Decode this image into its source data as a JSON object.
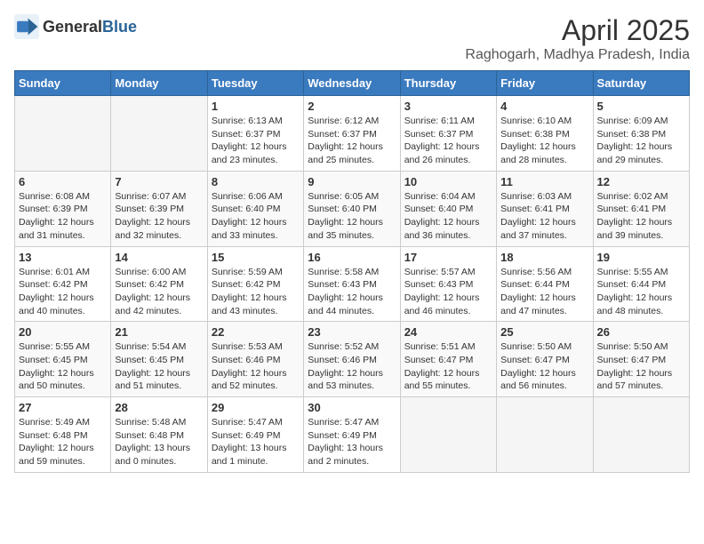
{
  "header": {
    "logo_general": "General",
    "logo_blue": "Blue",
    "title": "April 2025",
    "subtitle": "Raghogarh, Madhya Pradesh, India"
  },
  "calendar": {
    "days_of_week": [
      "Sunday",
      "Monday",
      "Tuesday",
      "Wednesday",
      "Thursday",
      "Friday",
      "Saturday"
    ],
    "weeks": [
      [
        {
          "day": "",
          "sunrise": "",
          "sunset": "",
          "daylight": ""
        },
        {
          "day": "",
          "sunrise": "",
          "sunset": "",
          "daylight": ""
        },
        {
          "day": "1",
          "sunrise": "Sunrise: 6:13 AM",
          "sunset": "Sunset: 6:37 PM",
          "daylight": "Daylight: 12 hours and 23 minutes."
        },
        {
          "day": "2",
          "sunrise": "Sunrise: 6:12 AM",
          "sunset": "Sunset: 6:37 PM",
          "daylight": "Daylight: 12 hours and 25 minutes."
        },
        {
          "day": "3",
          "sunrise": "Sunrise: 6:11 AM",
          "sunset": "Sunset: 6:37 PM",
          "daylight": "Daylight: 12 hours and 26 minutes."
        },
        {
          "day": "4",
          "sunrise": "Sunrise: 6:10 AM",
          "sunset": "Sunset: 6:38 PM",
          "daylight": "Daylight: 12 hours and 28 minutes."
        },
        {
          "day": "5",
          "sunrise": "Sunrise: 6:09 AM",
          "sunset": "Sunset: 6:38 PM",
          "daylight": "Daylight: 12 hours and 29 minutes."
        }
      ],
      [
        {
          "day": "6",
          "sunrise": "Sunrise: 6:08 AM",
          "sunset": "Sunset: 6:39 PM",
          "daylight": "Daylight: 12 hours and 31 minutes."
        },
        {
          "day": "7",
          "sunrise": "Sunrise: 6:07 AM",
          "sunset": "Sunset: 6:39 PM",
          "daylight": "Daylight: 12 hours and 32 minutes."
        },
        {
          "day": "8",
          "sunrise": "Sunrise: 6:06 AM",
          "sunset": "Sunset: 6:40 PM",
          "daylight": "Daylight: 12 hours and 33 minutes."
        },
        {
          "day": "9",
          "sunrise": "Sunrise: 6:05 AM",
          "sunset": "Sunset: 6:40 PM",
          "daylight": "Daylight: 12 hours and 35 minutes."
        },
        {
          "day": "10",
          "sunrise": "Sunrise: 6:04 AM",
          "sunset": "Sunset: 6:40 PM",
          "daylight": "Daylight: 12 hours and 36 minutes."
        },
        {
          "day": "11",
          "sunrise": "Sunrise: 6:03 AM",
          "sunset": "Sunset: 6:41 PM",
          "daylight": "Daylight: 12 hours and 37 minutes."
        },
        {
          "day": "12",
          "sunrise": "Sunrise: 6:02 AM",
          "sunset": "Sunset: 6:41 PM",
          "daylight": "Daylight: 12 hours and 39 minutes."
        }
      ],
      [
        {
          "day": "13",
          "sunrise": "Sunrise: 6:01 AM",
          "sunset": "Sunset: 6:42 PM",
          "daylight": "Daylight: 12 hours and 40 minutes."
        },
        {
          "day": "14",
          "sunrise": "Sunrise: 6:00 AM",
          "sunset": "Sunset: 6:42 PM",
          "daylight": "Daylight: 12 hours and 42 minutes."
        },
        {
          "day": "15",
          "sunrise": "Sunrise: 5:59 AM",
          "sunset": "Sunset: 6:42 PM",
          "daylight": "Daylight: 12 hours and 43 minutes."
        },
        {
          "day": "16",
          "sunrise": "Sunrise: 5:58 AM",
          "sunset": "Sunset: 6:43 PM",
          "daylight": "Daylight: 12 hours and 44 minutes."
        },
        {
          "day": "17",
          "sunrise": "Sunrise: 5:57 AM",
          "sunset": "Sunset: 6:43 PM",
          "daylight": "Daylight: 12 hours and 46 minutes."
        },
        {
          "day": "18",
          "sunrise": "Sunrise: 5:56 AM",
          "sunset": "Sunset: 6:44 PM",
          "daylight": "Daylight: 12 hours and 47 minutes."
        },
        {
          "day": "19",
          "sunrise": "Sunrise: 5:55 AM",
          "sunset": "Sunset: 6:44 PM",
          "daylight": "Daylight: 12 hours and 48 minutes."
        }
      ],
      [
        {
          "day": "20",
          "sunrise": "Sunrise: 5:55 AM",
          "sunset": "Sunset: 6:45 PM",
          "daylight": "Daylight: 12 hours and 50 minutes."
        },
        {
          "day": "21",
          "sunrise": "Sunrise: 5:54 AM",
          "sunset": "Sunset: 6:45 PM",
          "daylight": "Daylight: 12 hours and 51 minutes."
        },
        {
          "day": "22",
          "sunrise": "Sunrise: 5:53 AM",
          "sunset": "Sunset: 6:46 PM",
          "daylight": "Daylight: 12 hours and 52 minutes."
        },
        {
          "day": "23",
          "sunrise": "Sunrise: 5:52 AM",
          "sunset": "Sunset: 6:46 PM",
          "daylight": "Daylight: 12 hours and 53 minutes."
        },
        {
          "day": "24",
          "sunrise": "Sunrise: 5:51 AM",
          "sunset": "Sunset: 6:47 PM",
          "daylight": "Daylight: 12 hours and 55 minutes."
        },
        {
          "day": "25",
          "sunrise": "Sunrise: 5:50 AM",
          "sunset": "Sunset: 6:47 PM",
          "daylight": "Daylight: 12 hours and 56 minutes."
        },
        {
          "day": "26",
          "sunrise": "Sunrise: 5:50 AM",
          "sunset": "Sunset: 6:47 PM",
          "daylight": "Daylight: 12 hours and 57 minutes."
        }
      ],
      [
        {
          "day": "27",
          "sunrise": "Sunrise: 5:49 AM",
          "sunset": "Sunset: 6:48 PM",
          "daylight": "Daylight: 12 hours and 59 minutes."
        },
        {
          "day": "28",
          "sunrise": "Sunrise: 5:48 AM",
          "sunset": "Sunset: 6:48 PM",
          "daylight": "Daylight: 13 hours and 0 minutes."
        },
        {
          "day": "29",
          "sunrise": "Sunrise: 5:47 AM",
          "sunset": "Sunset: 6:49 PM",
          "daylight": "Daylight: 13 hours and 1 minute."
        },
        {
          "day": "30",
          "sunrise": "Sunrise: 5:47 AM",
          "sunset": "Sunset: 6:49 PM",
          "daylight": "Daylight: 13 hours and 2 minutes."
        },
        {
          "day": "",
          "sunrise": "",
          "sunset": "",
          "daylight": ""
        },
        {
          "day": "",
          "sunrise": "",
          "sunset": "",
          "daylight": ""
        },
        {
          "day": "",
          "sunrise": "",
          "sunset": "",
          "daylight": ""
        }
      ]
    ]
  }
}
